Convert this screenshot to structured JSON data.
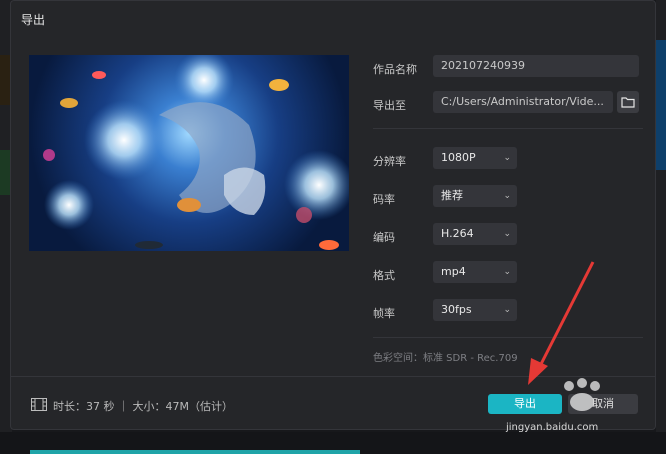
{
  "dialog": {
    "title": "导出"
  },
  "fields": {
    "name_label": "作品名称",
    "name_value": "202107240939",
    "export_to_label": "导出至",
    "export_to_value": "C:/Users/Administrator/Vide..."
  },
  "settings": [
    {
      "label": "分辨率",
      "value": "1080P"
    },
    {
      "label": "码率",
      "value": "推荐"
    },
    {
      "label": "编码",
      "value": "H.264"
    },
    {
      "label": "格式",
      "value": "mp4"
    },
    {
      "label": "帧率",
      "value": "30fps"
    }
  ],
  "color_space": "色彩空间：标准 SDR - Rec.709",
  "footer": {
    "info": "时长：37 秒 ｜ 大小：47M（估计）",
    "export_button": "导出",
    "cancel_button": "取消"
  },
  "watermark": {
    "text": "jingyan.baidu.com"
  },
  "icons": {
    "folder": "folder-icon",
    "film": "film-icon",
    "chevron": "chevron-down-icon"
  },
  "colors": {
    "accent": "#1bb5c4",
    "arrow": "#e53935",
    "dialog_bg": "#252629"
  }
}
